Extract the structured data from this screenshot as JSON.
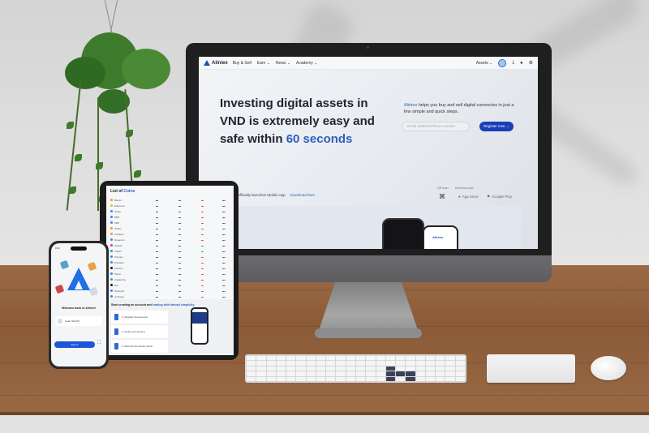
{
  "scene": "Device mockup of Aliniex crypto exchange on desktop, tablet and phone",
  "desktop": {
    "nav": {
      "brand": "Aliniex",
      "items": [
        {
          "label": "Buy & Sell",
          "has_dropdown": false
        },
        {
          "label": "Earn",
          "has_dropdown": true
        },
        {
          "label": "News",
          "has_dropdown": true
        },
        {
          "label": "Academy",
          "has_dropdown": true
        }
      ],
      "assets_label": "Assets",
      "icons": [
        "avatar-icon",
        "download-icon",
        "bell-icon",
        "globe-icon"
      ]
    },
    "hero": {
      "title_line1": "Investing digital assets in",
      "title_line2": "VND is extremely easy and",
      "title_line3_prefix": "safe within ",
      "title_accent": "60 seconds",
      "desc_brand": "Aliniex",
      "desc_rest": " helps you buy and sell digital currencies in just a few simple and quick steps.",
      "email_placeholder": "Email address/Phone number",
      "register_label": "Register now →"
    },
    "app_promo": {
      "text": "officially launches Mobile App",
      "link": "Download here",
      "qr_label": "QR scan",
      "download_label": "Download App",
      "app_store": "App Store",
      "google_play": "Google Play",
      "mini_brand": "Aliniex"
    }
  },
  "tablet": {
    "title_prefix": "List of ",
    "title_accent": "Coins",
    "rows": [
      {
        "name": "Bitcoin",
        "color": "#f7931a",
        "chg": "red"
      },
      {
        "name": "Ethereum",
        "color": "#f0b90b",
        "chg": "red"
      },
      {
        "name": "Tether",
        "color": "#3b82f6",
        "chg": "red"
      },
      {
        "name": "BNB",
        "color": "#3b82f6",
        "chg": "red"
      },
      {
        "name": "XRP",
        "color": "#3b82f6",
        "chg": "red"
      },
      {
        "name": "USDC",
        "color": "#f7931a",
        "chg": "red"
      },
      {
        "name": "Cardano",
        "color": "#f7931a",
        "chg": "red"
      },
      {
        "name": "Dogecoin",
        "color": "#3b82f6",
        "chg": "red"
      },
      {
        "name": "Solana",
        "color": "#ef4444",
        "chg": "green"
      },
      {
        "name": "TRON",
        "color": "#3b82f6",
        "chg": "green"
      },
      {
        "name": "Polygon",
        "color": "#3b82f6",
        "chg": "red"
      },
      {
        "name": "Polkadot",
        "color": "#3b82f6",
        "chg": "red"
      },
      {
        "name": "Litecoin",
        "color": "#111827",
        "chg": "red"
      },
      {
        "name": "Shiba",
        "color": "#3b82f6",
        "chg": "red"
      },
      {
        "name": "Avalanche",
        "color": "#10b981",
        "chg": "red"
      },
      {
        "name": "Dai",
        "color": "#111827",
        "chg": "red"
      },
      {
        "name": "Wrapped",
        "color": "#3b82f6",
        "chg": "red"
      },
      {
        "name": "Uniswap",
        "color": "#3b82f6",
        "chg": "red"
      }
    ],
    "cta": {
      "title_prefix": "Start creating an account and ",
      "title_accent": "trading with utmost simplicity",
      "steps": [
        "1. Register free Account",
        "2. Verify your account",
        "3. Discover the Aliniex world"
      ]
    }
  },
  "phone": {
    "time": "9:41",
    "welcome": "Welcome back to Aliniex!",
    "account_name": "Hoan NGUỖI",
    "signin_label": "Sign in"
  },
  "colors": {
    "brand_blue": "#1a3fb5",
    "accent_blue": "#2b5fc1",
    "text_dark": "#1f2430"
  }
}
